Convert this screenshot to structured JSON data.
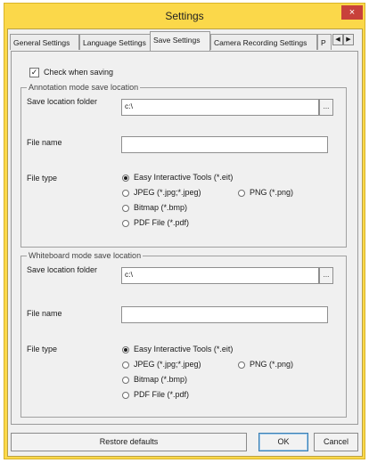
{
  "window": {
    "title": "Settings",
    "close_glyph": "×"
  },
  "tabs": [
    {
      "label": "General Settings"
    },
    {
      "label": "Language Settings"
    },
    {
      "label": "Save Settings"
    },
    {
      "label": "Camera Recording Settings"
    },
    {
      "label": "P"
    }
  ],
  "tab_scroll": {
    "left": "◀",
    "right": "▶"
  },
  "check_when_saving": {
    "label": "Check when saving",
    "checked": true,
    "glyph": "✓"
  },
  "annotation": {
    "legend": "Annotation mode save location",
    "folder_label": "Save location folder",
    "folder_value": "c:\\",
    "browse": "...",
    "file_name_label": "File name",
    "file_name_value": "",
    "file_type_label": "File type",
    "options": {
      "eit": "Easy Interactive Tools (*.eit)",
      "jpeg": "JPEG (*.jpg;*.jpeg)",
      "png": "PNG (*.png)",
      "bmp": "Bitmap (*.bmp)",
      "pdf": "PDF File (*.pdf)"
    },
    "selected": "eit"
  },
  "whiteboard": {
    "legend": "Whiteboard mode save location",
    "folder_label": "Save location folder",
    "folder_value": "c:\\",
    "browse": "...",
    "file_name_label": "File name",
    "file_name_value": "",
    "file_type_label": "File type",
    "options": {
      "eit": "Easy Interactive Tools (*.eit)",
      "jpeg": "JPEG (*.jpg;*.jpeg)",
      "png": "PNG (*.png)",
      "bmp": "Bitmap (*.bmp)",
      "pdf": "PDF File (*.pdf)"
    },
    "selected": "eit"
  },
  "buttons": {
    "restore": "Restore defaults",
    "ok": "OK",
    "cancel": "Cancel"
  },
  "colors": {
    "title_bar": "#fbd84a",
    "close_button": "#c8413b",
    "dialog_bg": "#f0f0f0"
  }
}
